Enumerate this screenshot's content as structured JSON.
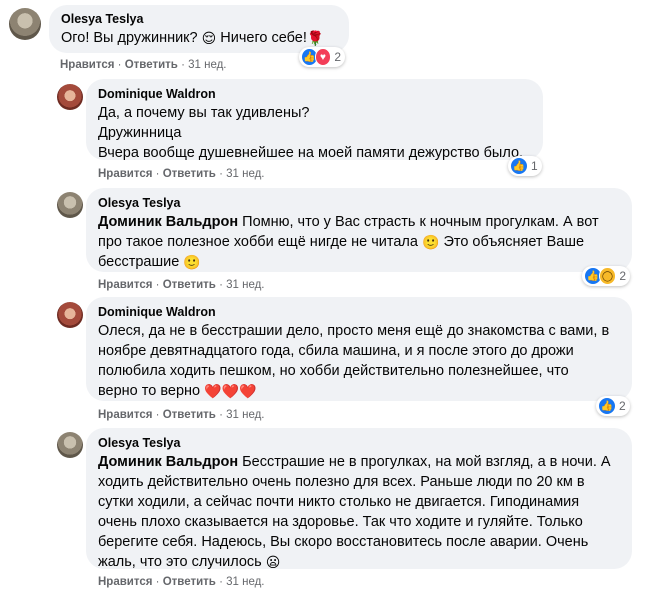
{
  "comments": [
    {
      "author": "Olesya Teslya",
      "lines": [
        "Ого! Вы дружинник?",
        "Ничего себе!"
      ],
      "emojis": [
        "😌",
        "🌹"
      ],
      "actions": {
        "like": "Нравится",
        "reply": "Ответить",
        "time": "31 нед."
      },
      "reactions": {
        "icons": [
          "like-icon",
          "love-icon"
        ],
        "count": "2"
      }
    },
    {
      "author": "Dominique Waldron",
      "lines": [
        "Да, а почему вы так удивлены?",
        "Дружинница",
        "Вчера вообще душевнейшее на моей памяти дежурство было."
      ],
      "actions": {
        "like": "Нравится",
        "reply": "Ответить",
        "time": "31 нед."
      },
      "reactions": {
        "icons": [
          "like-icon"
        ],
        "count": "1"
      }
    },
    {
      "author": "Olesya Teslya",
      "mention": "Доминик Вальдрон",
      "lines": [
        "Помню, что у Вас страсть к ночным прогулкам. А вот",
        "про такое полезное хобби ещё нигде не читала",
        "Это объясняет Ваше",
        "бесстрашие"
      ],
      "emojis": [
        "🙂",
        "🙂"
      ],
      "actions": {
        "like": "Нравится",
        "reply": "Ответить",
        "time": "31 нед."
      },
      "reactions": {
        "icons": [
          "like-icon",
          "wow-icon"
        ],
        "count": "2"
      }
    },
    {
      "author": "Dominique Waldron",
      "lines": [
        "Олеся, да не в бесстрашии дело, просто меня ещё до знакомства с вами, в",
        "ноябре девятнадцатого года, сбила машина, и я после этого до дрожи",
        "полюбила ходить пешком, но хобби действительно полезнейшее, что",
        "верно то верно"
      ],
      "emojis": [
        "❤️❤️❤️"
      ],
      "actions": {
        "like": "Нравится",
        "reply": "Ответить",
        "time": "31 нед."
      },
      "reactions": {
        "icons": [
          "like-icon"
        ],
        "count": "2"
      }
    },
    {
      "author": "Olesya Teslya",
      "mention": "Доминик Вальдрон",
      "lines": [
        "Бесстрашие не в прогулках, на мой взгляд, а в ночи. А",
        "ходить действительно очень полезно для всех. Раньше люди по 20 км в",
        "сутки ходили, а сейчас почти никто столько не двигается. Гиподинамия",
        "очень плохо сказывается на здоровье. Так что ходите и гуляйте. Только",
        "берегите себя. Надеюсь, Вы скоро восстановитесь после аварии. Очень",
        "жаль, что это случилось"
      ],
      "emojis": [
        "😦"
      ],
      "actions": {
        "like": "Нравится",
        "reply": "Ответить",
        "time": "31 нед."
      }
    }
  ],
  "separator": "·"
}
